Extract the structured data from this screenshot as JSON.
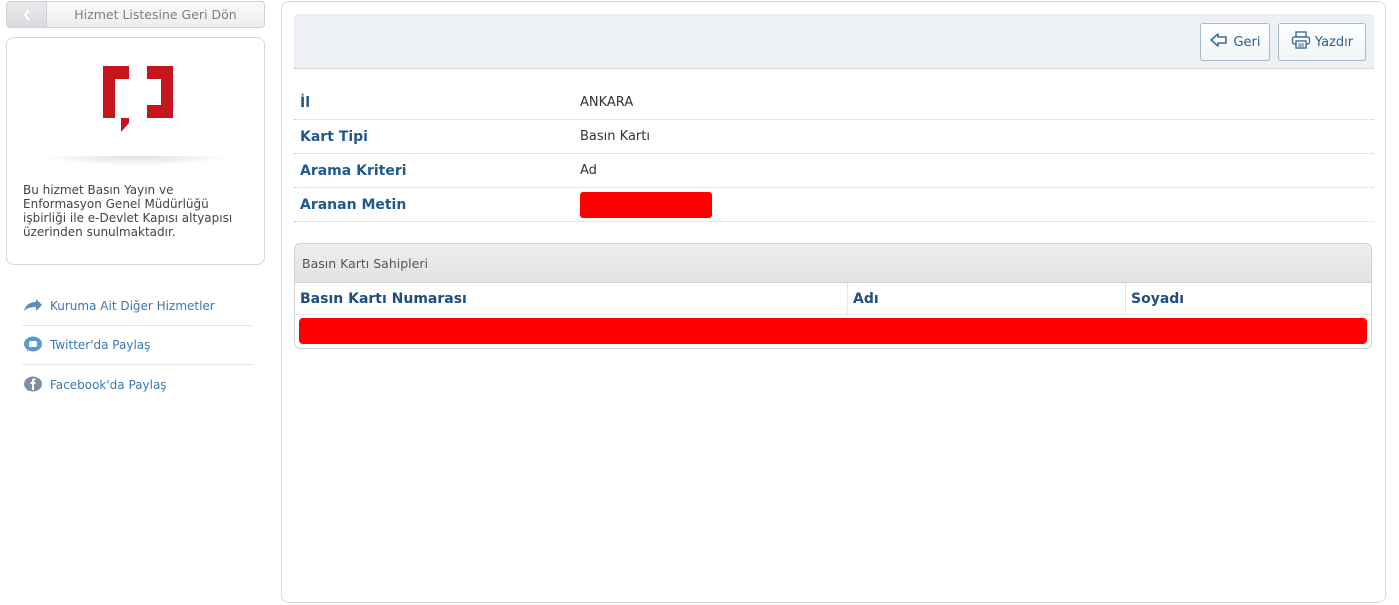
{
  "left": {
    "back_label": "Hizmet Listesine Geri Dön",
    "info_text": "Bu hizmet Basın Yayın ve Enformasyon Genel Müdürlüğü işbirliği ile e-Devlet Kapısı altyapısı üzerinden sunulmaktadır.",
    "links": [
      {
        "label": "Kuruma Ait Diğer Hizmetler",
        "icon": "arrow-share-icon"
      },
      {
        "label": "Twitter'da Paylaş",
        "icon": "twitter-icon"
      },
      {
        "label": "Facebook'da Paylaş",
        "icon": "facebook-icon"
      }
    ],
    "brand_color": "#c4161c"
  },
  "toolbar": {
    "back_label": "Geri",
    "print_label": "Yazdır"
  },
  "details": [
    {
      "label": "İl",
      "value": "ANKARA"
    },
    {
      "label": "Kart Tipi",
      "value": "Basın Kartı"
    },
    {
      "label": "Arama Kriteri",
      "value": "Ad"
    },
    {
      "label": "Aranan Metin",
      "value": ""
    }
  ],
  "owners": {
    "title": "Basın Kartı Sahipleri",
    "columns": [
      "Basın Kartı Numarası",
      "Adı",
      "Soyadı"
    ]
  },
  "colors": {
    "label_blue": "#1f5a8e",
    "link_blue": "#3a78b0",
    "redaction": "#ff0000",
    "toolbar_bg": "#edf1f6"
  }
}
